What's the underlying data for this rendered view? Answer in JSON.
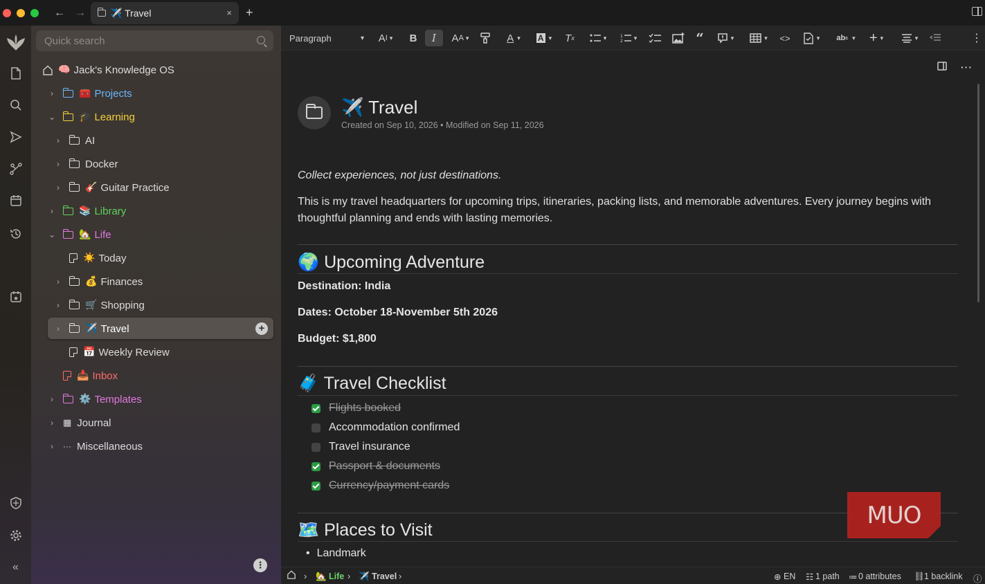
{
  "titlebar": {
    "tab_title": "✈️ Travel",
    "tab_close": "×",
    "new_tab": "+",
    "back": "←",
    "forward": "→",
    "traffic_colors": [
      "#ff5f57",
      "#febc2e",
      "#28c840"
    ]
  },
  "launcher": {
    "icons": [
      "logo-icon",
      "note-icon",
      "search-icon",
      "send-icon",
      "graph-icon",
      "calendar-icon",
      "history-icon",
      "calendar-star-icon",
      "shield-icon",
      "gear-icon",
      "collapse-icon"
    ]
  },
  "sidebar": {
    "search_placeholder": "Quick search",
    "root": {
      "label": "Jack's Knowledge OS",
      "emoji": "🧠"
    },
    "items": [
      {
        "label": "Projects",
        "emoji": "🧰",
        "color": "#6bb6ff",
        "chev": "›",
        "type": "folder"
      },
      {
        "label": "Learning",
        "emoji": "🎓",
        "color": "#f2d03a",
        "chev": "⌄",
        "type": "folder"
      },
      {
        "label": "AI",
        "emoji": "",
        "color": "#dcdcdc",
        "chev": "›",
        "type": "folder"
      },
      {
        "label": "Docker",
        "emoji": "",
        "color": "#dcdcdc",
        "chev": "›",
        "type": "folder"
      },
      {
        "label": "Guitar Practice",
        "emoji": "🎸",
        "color": "#dcdcdc",
        "chev": "›",
        "type": "folder"
      },
      {
        "label": "Library",
        "emoji": "📚",
        "color": "#5fd35f",
        "chev": "›",
        "type": "folder"
      },
      {
        "label": "Life",
        "emoji": "🏡",
        "color": "#e07be0",
        "chev": "⌄",
        "type": "folder"
      },
      {
        "label": "Today",
        "emoji": "☀️",
        "color": "#dcdcdc",
        "chev": "",
        "type": "note"
      },
      {
        "label": "Finances",
        "emoji": "💰",
        "color": "#dcdcdc",
        "chev": "›",
        "type": "folder"
      },
      {
        "label": "Shopping",
        "emoji": "🛒",
        "color": "#dcdcdc",
        "chev": "›",
        "type": "folder"
      },
      {
        "label": "Travel",
        "emoji": "✈️",
        "color": "#ffffff",
        "chev": "›",
        "type": "folder"
      },
      {
        "label": "Weekly Review",
        "emoji": "📅",
        "color": "#dcdcdc",
        "chev": "",
        "type": "note"
      },
      {
        "label": "Inbox",
        "emoji": "📥",
        "color": "#ff6b6b",
        "chev": "",
        "type": "note"
      },
      {
        "label": "Templates",
        "emoji": "⚙️",
        "color": "#e07be0",
        "chev": "›",
        "type": "folder"
      },
      {
        "label": "Journal",
        "emoji": "",
        "color": "#dcdcdc",
        "chev": "›",
        "type": "calendar"
      },
      {
        "label": "Miscellaneous",
        "emoji": "",
        "color": "#dcdcdc",
        "chev": "›",
        "type": "dots"
      }
    ],
    "plus": "+",
    "kebab": "⋮"
  },
  "toolbar": {
    "paragraph": "Paragraph"
  },
  "note": {
    "title": "✈️ Travel",
    "meta": "Created on Sep 10, 2026 • Modified on Sep 11, 2026",
    "quote": "Collect experiences, not just destinations.",
    "intro": "This is my travel headquarters for upcoming trips, itineraries, packing lists, and memorable adventures. Every journey begins with thoughtful planning and ends with lasting memories.",
    "h_adventure": "🌍 Upcoming Adventure",
    "destination": "Destination: India",
    "dates": "Dates: October 18-November 5th 2026",
    "budget": "Budget: $1,800",
    "h_checklist": "🧳 Travel Checklist",
    "checklist": [
      {
        "text": "Flights booked",
        "done": true
      },
      {
        "text": "Accommodation confirmed",
        "done": false
      },
      {
        "text": "Travel insurance",
        "done": false
      },
      {
        "text": "Passport & documents",
        "done": true
      },
      {
        "text": "Currency/payment cards",
        "done": true
      }
    ],
    "h_places": "🗺️ Places to Visit",
    "places": [
      "Landmark"
    ]
  },
  "statusbar": {
    "crumb_life": "🏡 Life",
    "crumb_travel": "✈️ Travel",
    "lang": "EN",
    "path": "1 path",
    "attributes": "0 attributes",
    "backlink": "1 backlink"
  },
  "watermark": "MUO"
}
